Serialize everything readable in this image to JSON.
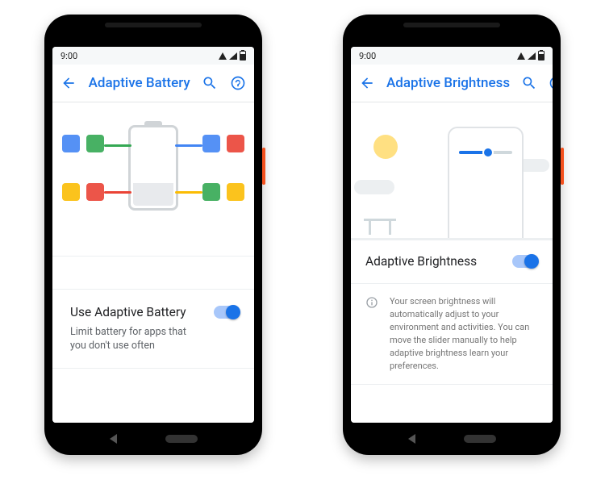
{
  "left": {
    "status_time": "9:00",
    "title": "Adaptive Battery",
    "setting_label": "Use Adaptive Battery",
    "setting_desc": "Limit battery for apps that you don't use often"
  },
  "right": {
    "status_time": "9:00",
    "title": "Adaptive Brightness",
    "setting_label": "Adaptive Brightness",
    "info_text": "Your screen brightness will automatically adjust to your environment and activities. You can move the slider manually to help adaptive brightness learn your preferences."
  }
}
